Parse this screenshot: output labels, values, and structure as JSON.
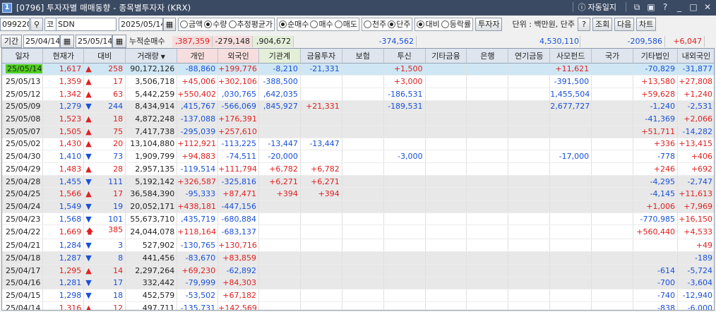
{
  "window": {
    "icon": "1",
    "title": "[0796] 투자자별 매매동향 - 종목별투자자 (KRX)",
    "auto_label": "자동일지"
  },
  "toolbar": {
    "code": "099220",
    "market": "코",
    "name": "SDN",
    "date": "2025/05/14",
    "radio_amount": "금액",
    "radio_qty": "수량",
    "radio_avg": "추정평균가",
    "radio_net": "순매수",
    "radio_buy": "매수",
    "radio_sell": "매도",
    "radio_thousand": "천주",
    "radio_share": "단주",
    "radio_compare": "대비",
    "radio_rate": "등락률",
    "investor_button": "투자자",
    "unit_label": "단위 : 백만원, 단주",
    "help_button": "?",
    "query_button": "조회",
    "next_button": "다음",
    "chart_button": "차트"
  },
  "period": {
    "label": "기간",
    "from": "25/04/14",
    "to": "25/05/14",
    "cum_label": "누적순매수"
  },
  "summary": {
    "individual": ",387,359",
    "foreign": "-279,148",
    "institution": ",904,672",
    "trust": "-374,562",
    "private_fund": "4,530,110",
    "other_corp": "-209,586",
    "domestic_foreign": "+6,047"
  },
  "columns": [
    "일자",
    "현재가",
    "대비",
    "거래량",
    "개인",
    "외국인",
    "기관계",
    "금융투자",
    "보험",
    "투신",
    "기타금융",
    "은행",
    "연기금등",
    "사모펀드",
    "국가",
    "기타법인",
    "내외국인"
  ],
  "rows": [
    {
      "date": "25/05/14",
      "price": "1,617",
      "dir": "up",
      "diff": "258",
      "volume": "90,172,126",
      "ind": "-88,860",
      "frn": "+199,776",
      "inst": "-8,210",
      "fin": "-21,331",
      "ins": "",
      "trust": "+1,500",
      "ofin": "",
      "bank": "",
      "pens": "",
      "priv": "+11,621",
      "gov": "",
      "ocorp": "-70,829",
      "dom": "-31,877"
    },
    {
      "date": "25/05/13",
      "price": "1,359",
      "dir": "up",
      "diff": "17",
      "volume": "3,506,718",
      "ind": "+45,006",
      "frn": "+302,106",
      "inst": "-388,500",
      "fin": "",
      "ins": "",
      "trust": "+3,000",
      "ofin": "",
      "bank": "",
      "pens": "",
      "priv": "-391,500",
      "gov": "",
      "ocorp": "+13,580",
      "dom": "+27,808"
    },
    {
      "date": "25/05/12",
      "price": "1,342",
      "dir": "up",
      "diff": "63",
      "volume": "5,442,259",
      "ind": "+550,402",
      "frn": ",030,765",
      "inst": ",642,035",
      "fin": "",
      "ins": "",
      "trust": "-186,531",
      "ofin": "",
      "bank": "",
      "pens": "",
      "priv": "1,455,504",
      "gov": "",
      "ocorp": "+59,628",
      "dom": "+1,240"
    },
    {
      "date": "25/05/09",
      "price": "1,279",
      "dir": "down",
      "diff": "244",
      "volume": "8,434,914",
      "ind": ",415,767",
      "frn": "-566,069",
      "inst": ",845,927",
      "fin": "+21,331",
      "ins": "",
      "trust": "-189,531",
      "ofin": "",
      "bank": "",
      "pens": "",
      "priv": "2,677,727",
      "gov": "",
      "ocorp": "-1,240",
      "dom": "-2,531"
    },
    {
      "date": "25/05/08",
      "price": "1,523",
      "dir": "up",
      "diff": "18",
      "volume": "4,872,248",
      "ind": "-137,088",
      "frn": "+176,391",
      "inst": "",
      "fin": "",
      "ins": "",
      "trust": "",
      "ofin": "",
      "bank": "",
      "pens": "",
      "priv": "",
      "gov": "",
      "ocorp": "-41,369",
      "dom": "+2,066"
    },
    {
      "date": "25/05/07",
      "price": "1,505",
      "dir": "up",
      "diff": "75",
      "volume": "7,417,738",
      "ind": "-295,039",
      "frn": "+257,610",
      "inst": "",
      "fin": "",
      "ins": "",
      "trust": "",
      "ofin": "",
      "bank": "",
      "pens": "",
      "priv": "",
      "gov": "",
      "ocorp": "+51,711",
      "dom": "-14,282"
    },
    {
      "date": "25/05/02",
      "price": "1,430",
      "dir": "up",
      "diff": "20",
      "volume": "13,104,880",
      "ind": "+112,921",
      "frn": "-113,225",
      "inst": "-13,447",
      "fin": "-13,447",
      "ins": "",
      "trust": "",
      "ofin": "",
      "bank": "",
      "pens": "",
      "priv": "",
      "gov": "",
      "ocorp": "+336",
      "dom": "+13,415"
    },
    {
      "date": "25/04/30",
      "price": "1,410",
      "dir": "down",
      "diff": "73",
      "volume": "1,909,799",
      "ind": "+94,883",
      "frn": "-74,511",
      "inst": "-20,000",
      "fin": "",
      "ins": "",
      "trust": "-3,000",
      "ofin": "",
      "bank": "",
      "pens": "",
      "priv": "-17,000",
      "gov": "",
      "ocorp": "-778",
      "dom": "+406"
    },
    {
      "date": "25/04/29",
      "price": "1,483",
      "dir": "up",
      "diff": "28",
      "volume": "2,957,135",
      "ind": "-119,514",
      "frn": "+111,794",
      "inst": "+6,782",
      "fin": "+6,782",
      "ins": "",
      "trust": "",
      "ofin": "",
      "bank": "",
      "pens": "",
      "priv": "",
      "gov": "",
      "ocorp": "+246",
      "dom": "+692"
    },
    {
      "date": "25/04/28",
      "price": "1,455",
      "dir": "down",
      "diff": "111",
      "volume": "5,192,142",
      "ind": "+326,587",
      "frn": "-325,816",
      "inst": "+6,271",
      "fin": "+6,271",
      "ins": "",
      "trust": "",
      "ofin": "",
      "bank": "",
      "pens": "",
      "priv": "",
      "gov": "",
      "ocorp": "-4,295",
      "dom": "-2,747"
    },
    {
      "date": "25/04/25",
      "price": "1,566",
      "dir": "up",
      "diff": "17",
      "volume": "36,584,390",
      "ind": "-95,333",
      "frn": "+87,471",
      "inst": "+394",
      "fin": "+394",
      "ins": "",
      "trust": "",
      "ofin": "",
      "bank": "",
      "pens": "",
      "priv": "",
      "gov": "",
      "ocorp": "-4,145",
      "dom": "+11,613"
    },
    {
      "date": "25/04/24",
      "price": "1,549",
      "dir": "down",
      "diff": "19",
      "volume": "20,052,171",
      "ind": "+438,181",
      "frn": "-447,156",
      "inst": "",
      "fin": "",
      "ins": "",
      "trust": "",
      "ofin": "",
      "bank": "",
      "pens": "",
      "priv": "",
      "gov": "",
      "ocorp": "+1,006",
      "dom": "+7,969"
    },
    {
      "date": "25/04/23",
      "price": "1,568",
      "dir": "down",
      "diff": "101",
      "volume": "55,673,710",
      "ind": ",435,719",
      "frn": "-680,884",
      "inst": "",
      "fin": "",
      "ins": "",
      "trust": "",
      "ofin": "",
      "bank": "",
      "pens": "",
      "priv": "",
      "gov": "",
      "ocorp": "-770,985",
      "dom": "+16,150"
    },
    {
      "date": "25/04/22",
      "price": "1,669",
      "dir": "limit",
      "diff": "385",
      "volume": "24,044,078",
      "ind": "+118,164",
      "frn": "-683,137",
      "inst": "",
      "fin": "",
      "ins": "",
      "trust": "",
      "ofin": "",
      "bank": "",
      "pens": "",
      "priv": "",
      "gov": "",
      "ocorp": "+560,440",
      "dom": "+4,533"
    },
    {
      "date": "25/04/21",
      "price": "1,284",
      "dir": "down",
      "diff": "3",
      "volume": "527,902",
      "ind": "-130,765",
      "frn": "+130,716",
      "inst": "",
      "fin": "",
      "ins": "",
      "trust": "",
      "ofin": "",
      "bank": "",
      "pens": "",
      "priv": "",
      "gov": "",
      "ocorp": "",
      "dom": "+49"
    },
    {
      "date": "25/04/18",
      "price": "1,287",
      "dir": "down",
      "diff": "8",
      "volume": "441,456",
      "ind": "-83,670",
      "frn": "+83,859",
      "inst": "",
      "fin": "",
      "ins": "",
      "trust": "",
      "ofin": "",
      "bank": "",
      "pens": "",
      "priv": "",
      "gov": "",
      "ocorp": "",
      "dom": "-189"
    },
    {
      "date": "25/04/17",
      "price": "1,295",
      "dir": "up",
      "diff": "14",
      "volume": "2,297,264",
      "ind": "+69,230",
      "frn": "-62,892",
      "inst": "",
      "fin": "",
      "ins": "",
      "trust": "",
      "ofin": "",
      "bank": "",
      "pens": "",
      "priv": "",
      "gov": "",
      "ocorp": "-614",
      "dom": "-5,724"
    },
    {
      "date": "25/04/16",
      "price": "1,281",
      "dir": "down",
      "diff": "17",
      "volume": "332,442",
      "ind": "-79,999",
      "frn": "+84,303",
      "inst": "",
      "fin": "",
      "ins": "",
      "trust": "",
      "ofin": "",
      "bank": "",
      "pens": "",
      "priv": "",
      "gov": "",
      "ocorp": "-700",
      "dom": "-3,604"
    },
    {
      "date": "25/04/15",
      "price": "1,298",
      "dir": "down",
      "diff": "18",
      "volume": "452,579",
      "ind": "-53,502",
      "frn": "+67,182",
      "inst": "",
      "fin": "",
      "ins": "",
      "trust": "",
      "ofin": "",
      "bank": "",
      "pens": "",
      "priv": "",
      "gov": "",
      "ocorp": "-740",
      "dom": "-12,940"
    },
    {
      "date": "25/04/14",
      "price": "1,316",
      "dir": "up",
      "diff": "12",
      "volume": "497,711",
      "ind": "-135,731",
      "frn": "+142,569",
      "inst": "",
      "fin": "",
      "ins": "",
      "trust": "",
      "ofin": "",
      "bank": "",
      "pens": "",
      "priv": "",
      "gov": "",
      "ocorp": "-838",
      "dom": "-6,000"
    }
  ],
  "colors": {
    "up": "#e0201f",
    "down": "#1850d8",
    "selected_date_bg": "#4fd11f"
  },
  "icons": {
    "search": "search-icon",
    "calendar": "calendar-icon",
    "arrow_up": "triangle-up-icon",
    "arrow_down": "triangle-down-icon",
    "limit_up": "arrow-up-icon"
  }
}
